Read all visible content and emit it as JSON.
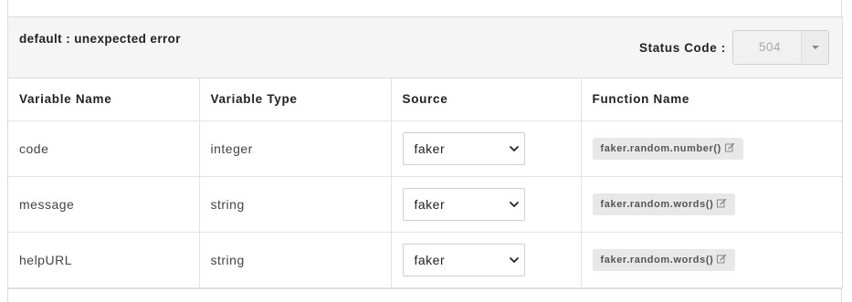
{
  "response": {
    "title": "default : unexpected error",
    "status_code_label": "Status Code :",
    "status_code_value": "504"
  },
  "table": {
    "headers": {
      "variable_name": "Variable Name",
      "variable_type": "Variable Type",
      "source": "Source",
      "function_name": "Function Name"
    },
    "rows": [
      {
        "name": "code",
        "type": "integer",
        "source": "faker",
        "function": "faker.random.number()"
      },
      {
        "name": "message",
        "type": "string",
        "source": "faker",
        "function": "faker.random.words()"
      },
      {
        "name": "helpURL",
        "type": "string",
        "source": "faker",
        "function": "faker.random.words()"
      }
    ]
  },
  "icons": {
    "status_dropdown": "caret-down-icon",
    "source_dropdown": "chevron-down-icon",
    "function_edit": "edit-icon"
  }
}
